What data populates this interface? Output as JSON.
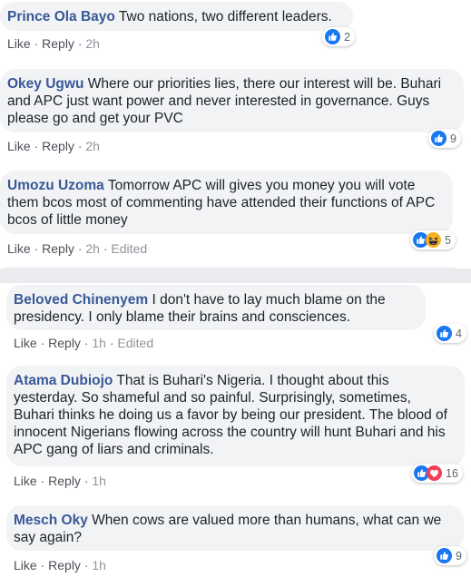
{
  "comments": [
    {
      "author": "Prince Ola Bayo",
      "text": "Two nations, two different leaders.",
      "like": "Like",
      "reply": "Reply",
      "time": "2h",
      "edited": "",
      "reactions": [
        "like"
      ],
      "count": "2"
    },
    {
      "author": "Okey Ugwu",
      "text": "Where our priorities lies, there our interest will be. Buhari and APC just want power and never interested in governance. Guys please go and get your PVC",
      "like": "Like",
      "reply": "Reply",
      "time": "2h",
      "edited": "",
      "reactions": [
        "like"
      ],
      "count": "9"
    },
    {
      "author": "Umozu Uzoma",
      "text": "Tomorrow APC will gives you money you will vote them bcos most of commenting have attended their functions of APC bcos of little money",
      "like": "Like",
      "reply": "Reply",
      "time": "2h",
      "edited": "Edited",
      "reactions": [
        "like",
        "haha"
      ],
      "count": "5"
    },
    {
      "author": "Beloved Chinenyem",
      "text": "I don't have to lay much blame on the presidency. I only blame their brains and consciences.",
      "like": "Like",
      "reply": "Reply",
      "time": "1h",
      "edited": "Edited",
      "reactions": [
        "like"
      ],
      "count": "4"
    },
    {
      "author": "Atama Dubiojo",
      "text": "That is Buhari's Nigeria. I thought about this yesterday. So shameful and so painful. Surprisingly, sometimes, Buhari thinks he doing us a favor by being our president. The blood of innocent Nigerians flowing across the country will hunt Buhari and his APC gang of liars and criminals.",
      "like": "Like",
      "reply": "Reply",
      "time": "1h",
      "edited": "",
      "reactions": [
        "like",
        "love"
      ],
      "count": "16"
    },
    {
      "author": "Mesch Oky",
      "text": "When cows are valued more than humans, what can we say again?",
      "like": "Like",
      "reply": "Reply",
      "time": "1h",
      "edited": "",
      "reactions": [
        "like"
      ],
      "count": "9"
    }
  ],
  "colors": {
    "link": "#385898",
    "like": "#1877f2",
    "love": "#f33e58",
    "haha": "#f7b125",
    "bubble": "#f2f3f5"
  }
}
